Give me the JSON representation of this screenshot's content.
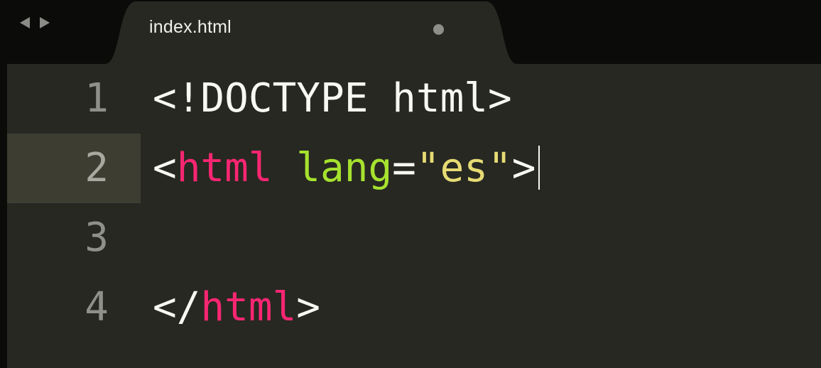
{
  "tab": {
    "title": "index.html",
    "dirty_indicator_icon": "dot-icon"
  },
  "nav": {
    "back_icon": "triangle-left-icon",
    "forward_icon": "triangle-right-icon"
  },
  "editor": {
    "active_line": 2,
    "lines": [
      {
        "number": "1",
        "tokens": {
          "a": "<!DOCTYPE html>"
        }
      },
      {
        "number": "2",
        "tokens": {
          "a": "<",
          "b": "html",
          "c": " ",
          "d": "lang",
          "e": "=",
          "f": "\"es\"",
          "g": ">"
        }
      },
      {
        "number": "3",
        "tokens": {}
      },
      {
        "number": "4",
        "tokens": {
          "a": "</",
          "b": "html",
          "c": ">"
        }
      }
    ]
  },
  "colors": {
    "background": "#272822",
    "tag": "#f92672",
    "attribute": "#a6e22e",
    "string": "#e6db74",
    "text": "#f8f8f2",
    "line_number": "#8f908a",
    "active_line_gutter": "#3e3d32",
    "tab_bar": "#0b0b0a"
  }
}
